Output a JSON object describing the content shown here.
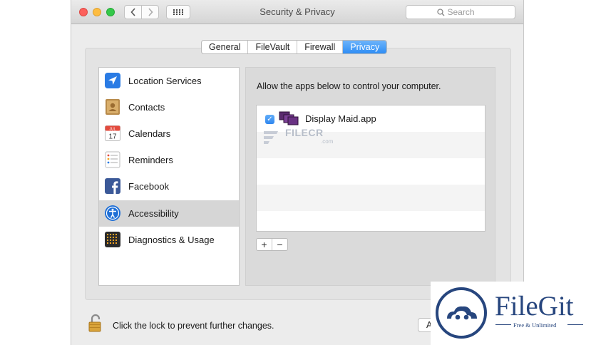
{
  "window": {
    "title": "Security & Privacy"
  },
  "search": {
    "placeholder": "Search"
  },
  "tabs": [
    {
      "label": "General"
    },
    {
      "label": "FileVault"
    },
    {
      "label": "Firewall"
    },
    {
      "label": "Privacy",
      "active": true
    }
  ],
  "sidebar": {
    "items": [
      {
        "label": "Location Services",
        "icon": "location-arrow-icon"
      },
      {
        "label": "Contacts",
        "icon": "contacts-book-icon"
      },
      {
        "label": "Calendars",
        "icon": "calendar-icon",
        "icon_text": {
          "month": "JUL",
          "day": "17"
        }
      },
      {
        "label": "Reminders",
        "icon": "reminders-list-icon"
      },
      {
        "label": "Facebook",
        "icon": "facebook-icon"
      },
      {
        "label": "Accessibility",
        "icon": "accessibility-icon",
        "selected": true
      },
      {
        "label": "Diagnostics & Usage",
        "icon": "diagnostics-grid-icon"
      }
    ]
  },
  "main": {
    "description": "Allow the apps below to control your computer.",
    "apps": [
      {
        "name": "Display Maid.app",
        "checked": true
      }
    ],
    "add_label": "+",
    "remove_label": "−"
  },
  "footer": {
    "lock_text": "Click the lock to prevent further changes.",
    "advanced_label": "Advanced..."
  },
  "watermarks": {
    "filecr": {
      "text": "FILECR",
      "suffix": ".com"
    },
    "filegit": {
      "name": "FileGit",
      "tagline": "Free & Unlimited"
    }
  },
  "colors": {
    "accent": "#2f8ef5",
    "selected_row": "#d6d6d6",
    "brand_filegit": "#27467e"
  }
}
